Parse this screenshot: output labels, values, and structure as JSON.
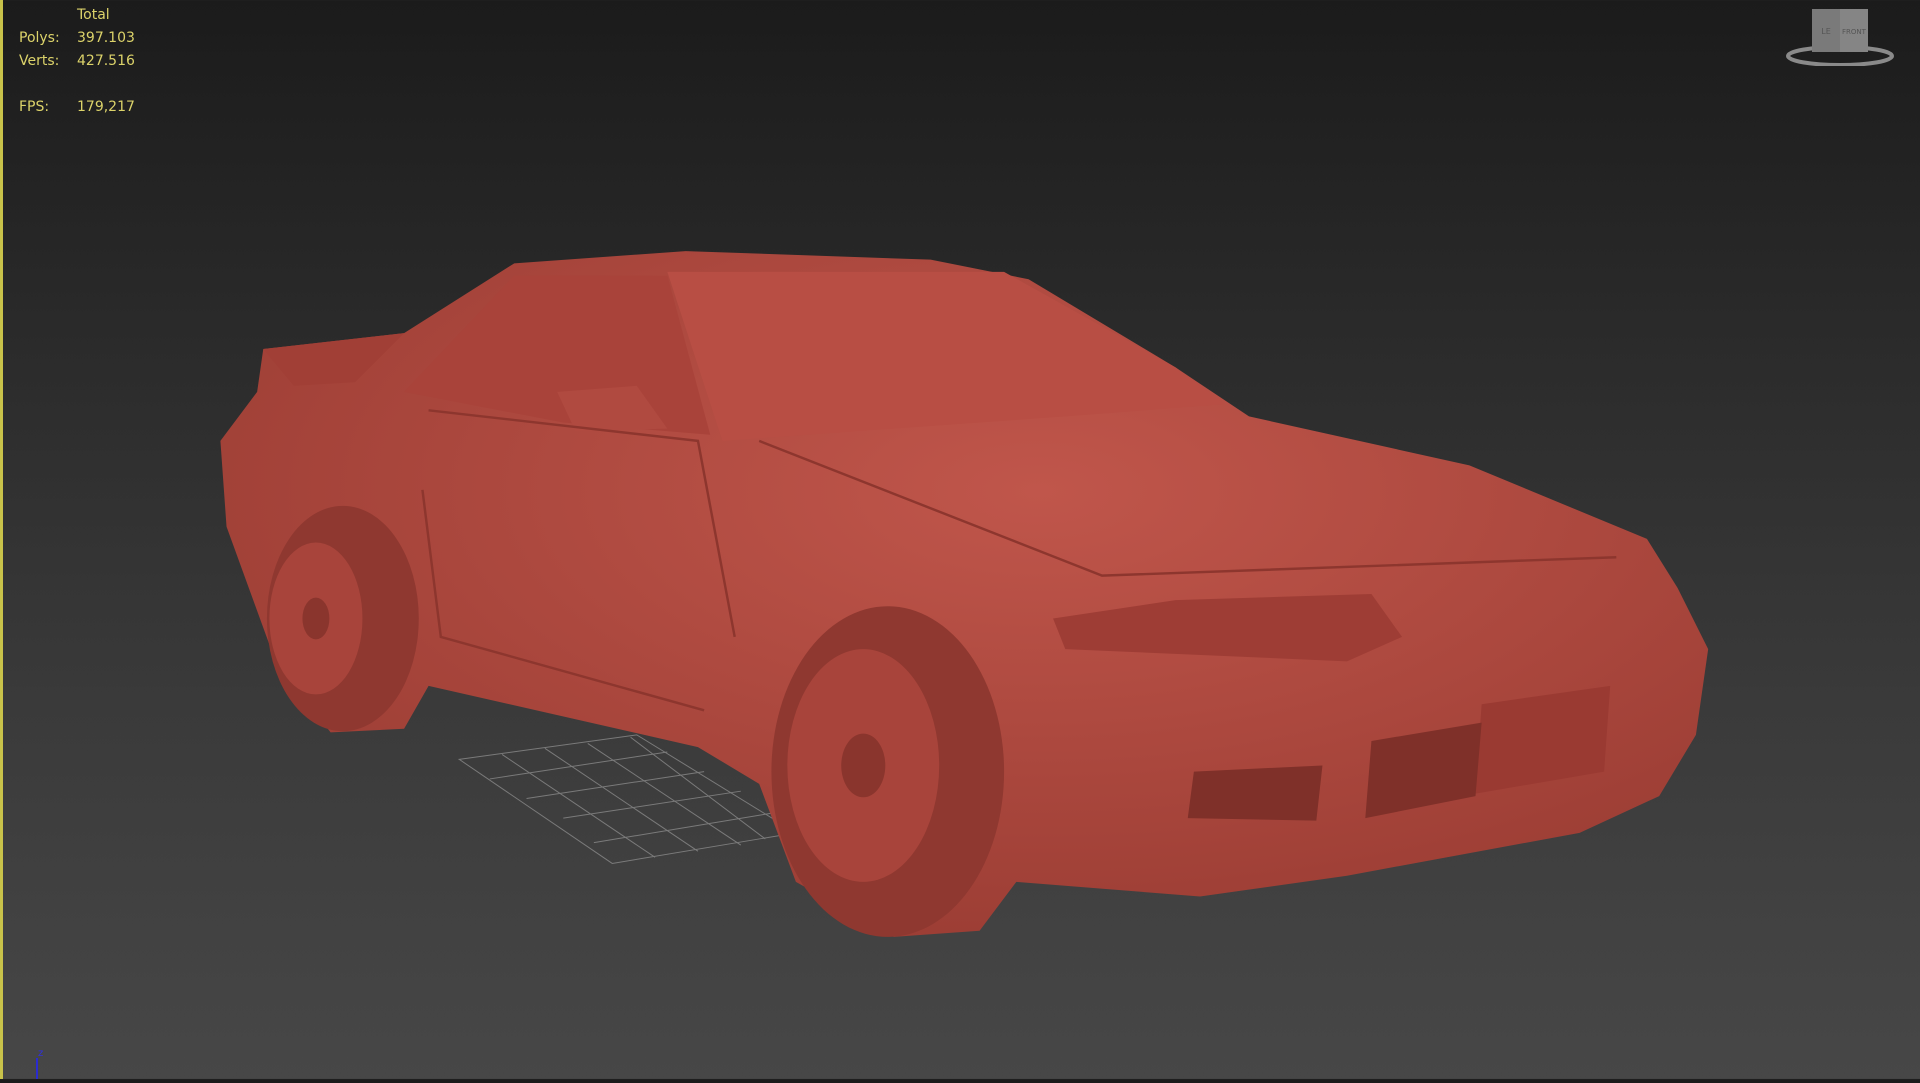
{
  "stats": {
    "header": "Total",
    "polys_label": "Polys:",
    "polys_value": "397.103",
    "verts_label": "Verts:",
    "verts_value": "427.516",
    "fps_label": "FPS:",
    "fps_value": "179,217"
  },
  "viewcube": {
    "left_face": "LE",
    "front_face": "FRONT"
  },
  "axis": {
    "z_label": "z"
  },
  "colors": {
    "model": "#b5493f",
    "stats_text": "#dcd36a",
    "active_border": "#c8c24a"
  }
}
